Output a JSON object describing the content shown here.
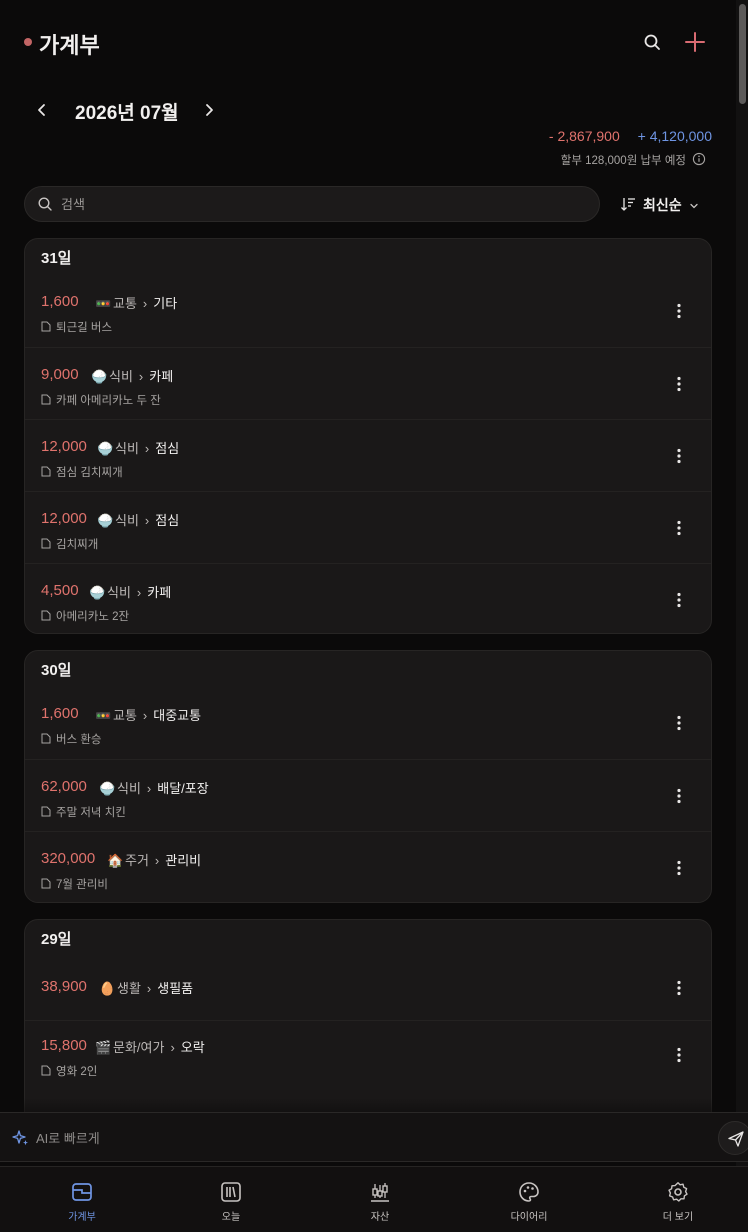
{
  "header": {
    "title": "가계부"
  },
  "month": {
    "label": "2026년 07월"
  },
  "totals": {
    "expense": "- 2,867,900",
    "income": "+ 4,120,000",
    "installment_note": "할부 128,000원 납부 예정"
  },
  "search": {
    "placeholder": "검색"
  },
  "sort": {
    "label": "최신순"
  },
  "days": [
    {
      "label": "31일",
      "items": [
        {
          "amount": "1,600",
          "emoji": "🚥",
          "category": "교통",
          "subcategory": "기타",
          "memo": "퇴근길 버스"
        },
        {
          "amount": "9,000",
          "emoji": "🍚",
          "category": "식비",
          "subcategory": "카페",
          "memo": "카페 아메리카노 두 잔"
        },
        {
          "amount": "12,000",
          "emoji": "🍚",
          "category": "식비",
          "subcategory": "점심",
          "memo": "점심 김치찌개"
        },
        {
          "amount": "12,000",
          "emoji": "🍚",
          "category": "식비",
          "subcategory": "점심",
          "memo": "김치찌개"
        },
        {
          "amount": "4,500",
          "emoji": "🍚",
          "category": "식비",
          "subcategory": "카페",
          "memo": "아메리카노 2잔"
        }
      ]
    },
    {
      "label": "30일",
      "items": [
        {
          "amount": "1,600",
          "emoji": "🚥",
          "category": "교통",
          "subcategory": "대중교통",
          "memo": "버스 환승"
        },
        {
          "amount": "62,000",
          "emoji": "🍚",
          "category": "식비",
          "subcategory": "배달/포장",
          "memo": "주말 저녁 치킨"
        },
        {
          "amount": "320,000",
          "emoji": "🏠",
          "category": "주거",
          "subcategory": "관리비",
          "memo": "7월 관리비"
        }
      ]
    },
    {
      "label": "29일",
      "items": [
        {
          "amount": "38,900",
          "emoji": "🥚",
          "category": "생활",
          "subcategory": "생필품",
          "memo": ""
        },
        {
          "amount": "15,800",
          "emoji": "🎬",
          "category": "문화/여가",
          "subcategory": "오락",
          "memo": "영화 2인"
        }
      ]
    }
  ],
  "ai": {
    "placeholder": "AI로 빠르게"
  },
  "nav": [
    {
      "label": "가계부",
      "icon": "ledger-icon",
      "active": true
    },
    {
      "label": "오늘",
      "icon": "today-icon",
      "active": false
    },
    {
      "label": "자산",
      "icon": "assets-icon",
      "active": false
    },
    {
      "label": "다이어리",
      "icon": "palette-icon",
      "active": false
    },
    {
      "label": "더 보기",
      "icon": "gear-icon",
      "active": false
    }
  ],
  "colors": {
    "expense": "#e0736d",
    "income": "#6f95e3",
    "accent_dot": "#c26565",
    "background": "#0b0a0a"
  }
}
